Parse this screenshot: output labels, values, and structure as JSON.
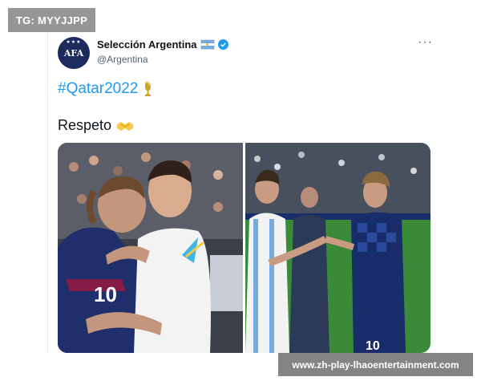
{
  "overlay_tag": "TG: MYYJJPP",
  "watermark": "www.zh-play-lhaoentertainment.com",
  "tweet": {
    "display_name": "Selección Argentina",
    "handle": "@Argentina",
    "avatar_text": "AFA",
    "hashtag": "#Qatar2022",
    "text": "Respeto",
    "more_label": "···"
  },
  "icons": {
    "flag": "argentina-flag-icon",
    "verified": "verified-badge-icon",
    "trophy": "trophy-icon",
    "handshake": "handshake-icon",
    "more": "more-options-icon"
  },
  "colors": {
    "link": "#1d9bf0",
    "argentina_blue": "#74acdf",
    "croatia_blue": "#1a2d6b",
    "pitch": "#3a8a3a"
  },
  "photos": {
    "left_jersey_number": "10",
    "right_jersey_number": "10"
  }
}
